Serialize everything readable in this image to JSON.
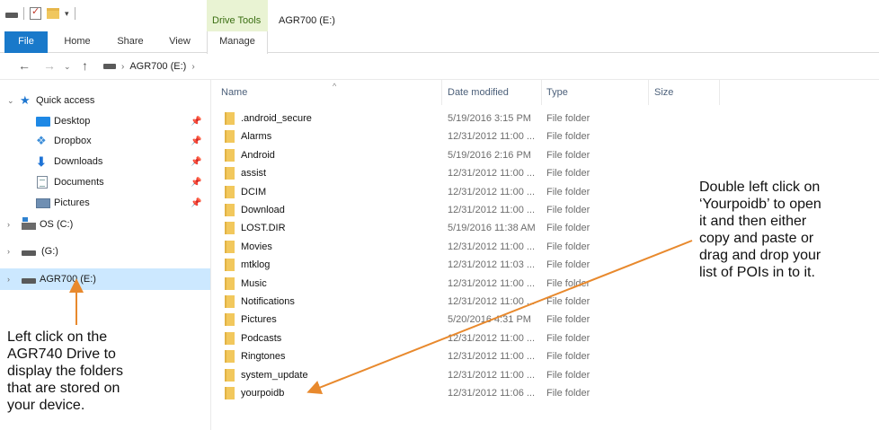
{
  "window": {
    "title": "AGR700 (E:)",
    "context_tab_group": "Drive Tools"
  },
  "quick_access_toolbar": {
    "icons": [
      "drive-icon",
      "properties-icon",
      "new-folder-icon",
      "customize-dropdown-icon"
    ],
    "dropdown_glyph": "▾"
  },
  "ribbon": {
    "tabs": [
      {
        "label": "File"
      },
      {
        "label": "Home"
      },
      {
        "label": "Share"
      },
      {
        "label": "View"
      },
      {
        "label": "Manage"
      }
    ]
  },
  "addressbar": {
    "back": "←",
    "forward": "→",
    "recent": "⌄",
    "up": "↑",
    "separator": "›",
    "path": [
      "AGR700 (E:)"
    ]
  },
  "navigation": {
    "expander_expanded": "⌄",
    "expander_collapsed": "›",
    "pin_glyph": "📌",
    "items": [
      {
        "label": "Quick access",
        "icon": "star-icon"
      },
      {
        "label": "Desktop",
        "icon": "desktop-icon",
        "pinned": true
      },
      {
        "label": "Dropbox",
        "icon": "dropbox-icon",
        "pinned": true
      },
      {
        "label": "Downloads",
        "icon": "downloads-icon",
        "pinned": true
      },
      {
        "label": "Documents",
        "icon": "documents-icon",
        "pinned": true
      },
      {
        "label": "Pictures",
        "icon": "pictures-icon",
        "pinned": true
      },
      {
        "label": "OS (C:)",
        "icon": "os-drive-icon"
      },
      {
        "label": "(G:)",
        "icon": "drive-icon"
      },
      {
        "label": "AGR700 (E:)",
        "icon": "drive-icon",
        "selected": true
      }
    ]
  },
  "columns": {
    "name": "Name",
    "date": "Date modified",
    "type": "Type",
    "size": "Size"
  },
  "files": [
    {
      "name": ".android_secure",
      "date": "5/19/2016 3:15 PM",
      "type": "File folder"
    },
    {
      "name": "Alarms",
      "date": "12/31/2012 11:00 ...",
      "type": "File folder"
    },
    {
      "name": "Android",
      "date": "5/19/2016 2:16 PM",
      "type": "File folder"
    },
    {
      "name": "assist",
      "date": "12/31/2012 11:00 ...",
      "type": "File folder"
    },
    {
      "name": "DCIM",
      "date": "12/31/2012 11:00 ...",
      "type": "File folder"
    },
    {
      "name": "Download",
      "date": "12/31/2012 11:00 ...",
      "type": "File folder"
    },
    {
      "name": "LOST.DIR",
      "date": "5/19/2016 11:38 AM",
      "type": "File folder"
    },
    {
      "name": "Movies",
      "date": "12/31/2012 11:00 ...",
      "type": "File folder"
    },
    {
      "name": "mtklog",
      "date": "12/31/2012 11:03 ...",
      "type": "File folder"
    },
    {
      "name": "Music",
      "date": "12/31/2012 11:00 ...",
      "type": "File folder"
    },
    {
      "name": "Notifications",
      "date": "12/31/2012 11:00 ...",
      "type": "File folder"
    },
    {
      "name": "Pictures",
      "date": "5/20/2016 4:31 PM",
      "type": "File folder"
    },
    {
      "name": "Podcasts",
      "date": "12/31/2012 11:00 ...",
      "type": "File folder"
    },
    {
      "name": "Ringtones",
      "date": "12/31/2012 11:00 ...",
      "type": "File folder"
    },
    {
      "name": "system_update",
      "date": "12/31/2012 11:00 ...",
      "type": "File folder"
    },
    {
      "name": "yourpoidb",
      "date": "12/31/2012 11:06 ...",
      "type": "File folder"
    }
  ],
  "annotations": {
    "left": "Left click on the\nAGR740 Drive to\ndisplay the folders\nthat are stored on\nyour device.",
    "right": "Double left click on\n‘Yourpoidb’ to open\nit and then either\ncopy and paste or\ndrag and drop your\nlist of POIs in to it.",
    "arrow_color": "#e8892d"
  }
}
